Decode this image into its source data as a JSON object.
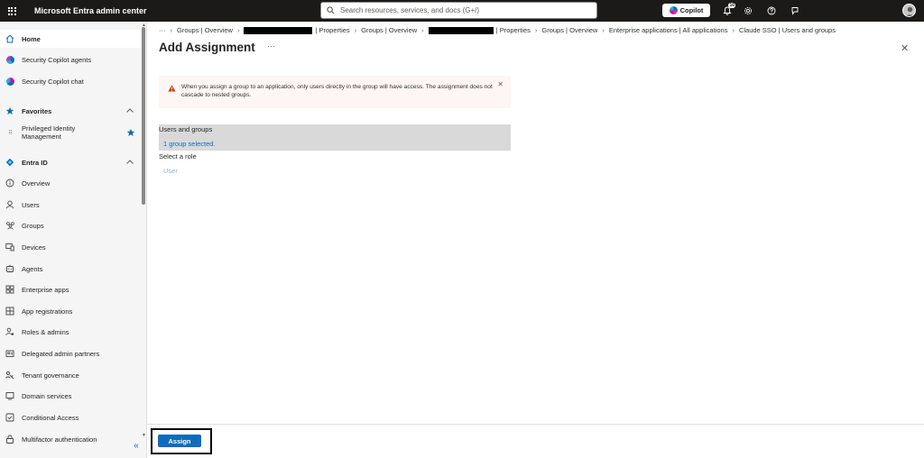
{
  "topbar": {
    "app_title": "Microsoft Entra admin center",
    "search_placeholder": "Search resources, services, and docs (G+/)",
    "copilot_label": "Copilot",
    "notification_count": "16"
  },
  "sidebar": {
    "home": "Home",
    "security_copilot_agents": "Security Copilot agents",
    "security_copilot_chat": "Security Copilot chat",
    "favorites": "Favorites",
    "pim_line1": "Privileged Identity",
    "pim_line2": "Management",
    "entra_id": "Entra ID",
    "items": [
      {
        "label": "Overview"
      },
      {
        "label": "Users"
      },
      {
        "label": "Groups"
      },
      {
        "label": "Devices"
      },
      {
        "label": "Agents"
      },
      {
        "label": "Enterprise apps"
      },
      {
        "label": "App registrations"
      },
      {
        "label": "Roles & admins"
      },
      {
        "label": "Delegated admin partners"
      },
      {
        "label": "Tenant governance"
      },
      {
        "label": "Domain services"
      },
      {
        "label": "Conditional Access"
      },
      {
        "label": "Multifactor authentication"
      }
    ]
  },
  "breadcrumb": {
    "ellipsis": "···",
    "items": [
      "Groups | Overview",
      "| Properties",
      "Groups | Overview",
      "| Properties",
      "Groups | Overview",
      "Enterprise applications | All applications",
      "Claude SSO | Users and groups"
    ]
  },
  "page": {
    "title": "Add Assignment",
    "more": "···",
    "close": "✕"
  },
  "warning": {
    "text": "When you assign a group to an application, only users directly in the group will have access. The assignment does not cascade to nested groups.",
    "close": "✕"
  },
  "users_groups": {
    "header": "Users and groups",
    "selected": "1 group selected."
  },
  "role": {
    "label": "Select a role",
    "value": "User"
  },
  "footer": {
    "assign_label": "Assign"
  },
  "colors": {
    "accent": "#0f6cbd",
    "topbar": "#1b1a19",
    "warning_bg": "#fdf6f3",
    "warning_icon": "#da3b01"
  }
}
